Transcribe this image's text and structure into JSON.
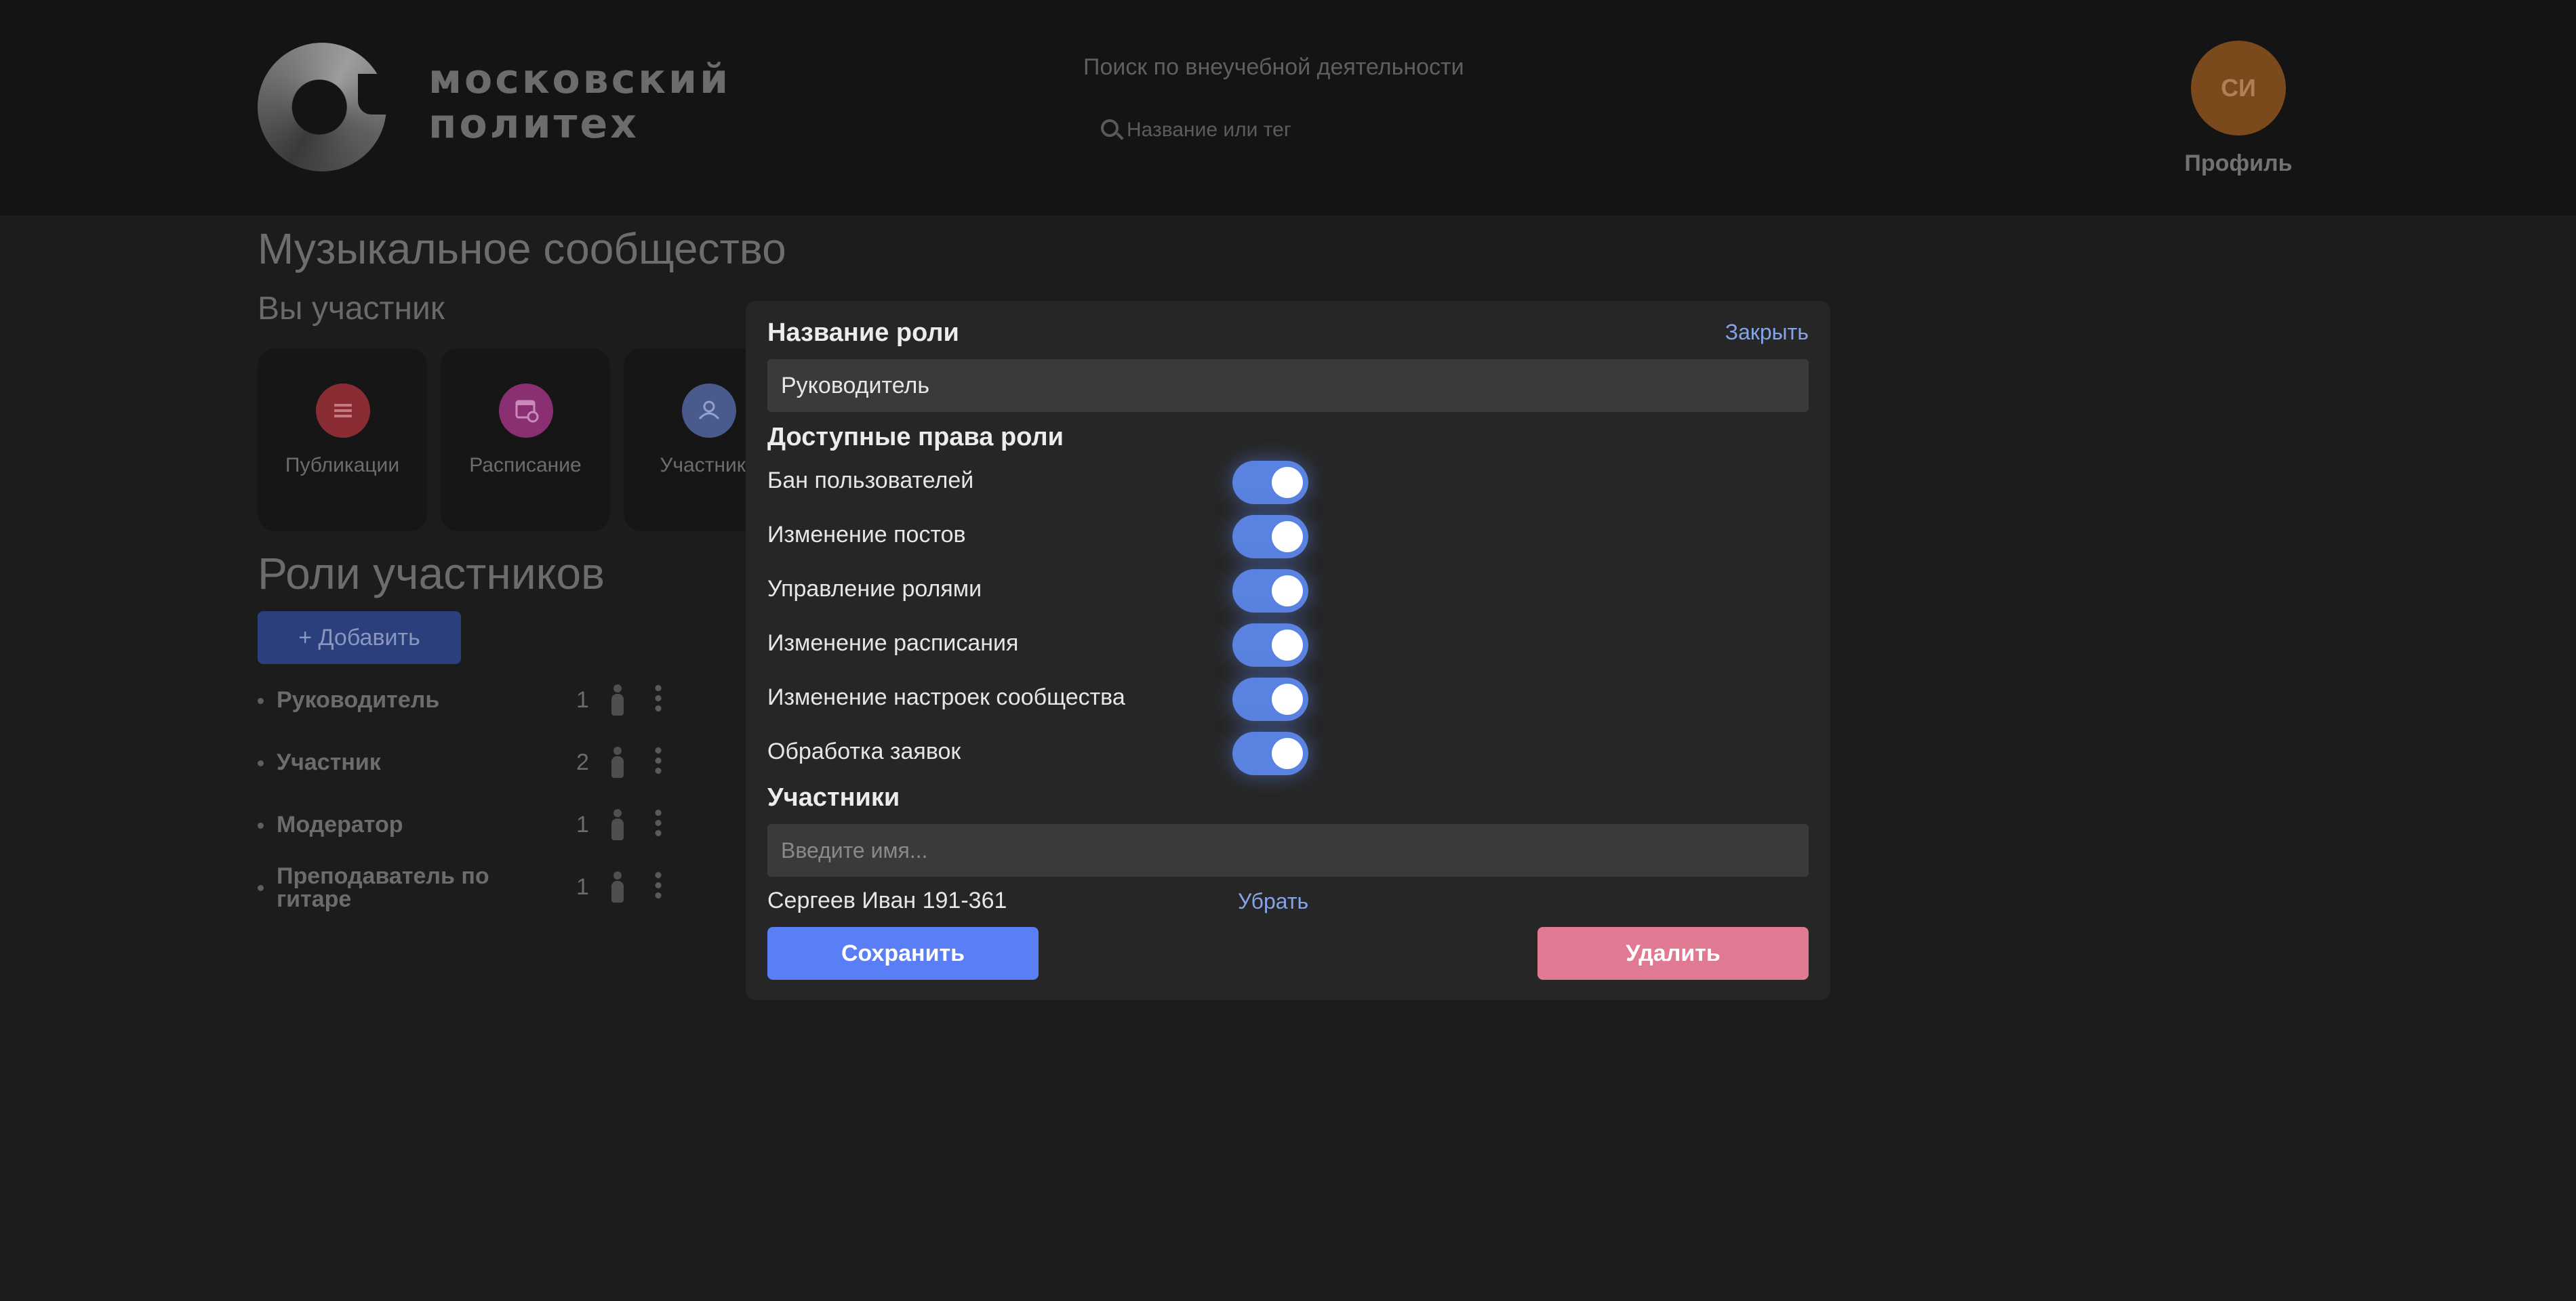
{
  "header": {
    "logo_line1": "московский",
    "logo_line2": "политех",
    "search_caption": "Поиск по внеучебной деятельности",
    "search_placeholder": "Название или тег",
    "avatar_initials": "СИ",
    "profile_label": "Профиль"
  },
  "community": {
    "title": "Музыкальное сообщество",
    "membership_status": "Вы участник",
    "cards": [
      {
        "label": "Публикации",
        "icon": "list-icon",
        "color": "#8a2c34"
      },
      {
        "label": "Расписание",
        "icon": "calendar-icon",
        "color": "#8a2f72"
      },
      {
        "label": "Участники",
        "icon": "group-icon",
        "color": "#4a5a8c"
      }
    ]
  },
  "roles": {
    "title": "Роли участников",
    "add_label": "+ Добавить",
    "items": [
      {
        "name": "Руководитель",
        "count": "1"
      },
      {
        "name": "Участник",
        "count": "2"
      },
      {
        "name": "Модератор",
        "count": "1"
      },
      {
        "name": "Преподаватель по гитаре",
        "count": "1"
      }
    ]
  },
  "modal": {
    "role_name_label": "Название роли",
    "close_label": "Закрыть",
    "role_name_value": "Руководитель",
    "permissions_title": "Доступные права роли",
    "permissions": [
      {
        "label": "Бан пользователей",
        "enabled": true
      },
      {
        "label": "Изменение постов",
        "enabled": true
      },
      {
        "label": "Управление ролями",
        "enabled": true
      },
      {
        "label": "Изменение расписания",
        "enabled": true
      },
      {
        "label": "Изменение настроек сообщества",
        "enabled": true
      },
      {
        "label": "Обработка заявок",
        "enabled": true
      }
    ],
    "members_title": "Участники",
    "member_placeholder": "Введите имя...",
    "member": {
      "name": "Сергеев Иван 191-361",
      "remove_label": "Убрать"
    },
    "save_label": "Сохранить",
    "delete_label": "Удалить"
  },
  "colors": {
    "accent": "#5a7ef5",
    "danger": "#e07a93",
    "toggle_on": "#5a82e0",
    "link": "#85a4e8"
  }
}
